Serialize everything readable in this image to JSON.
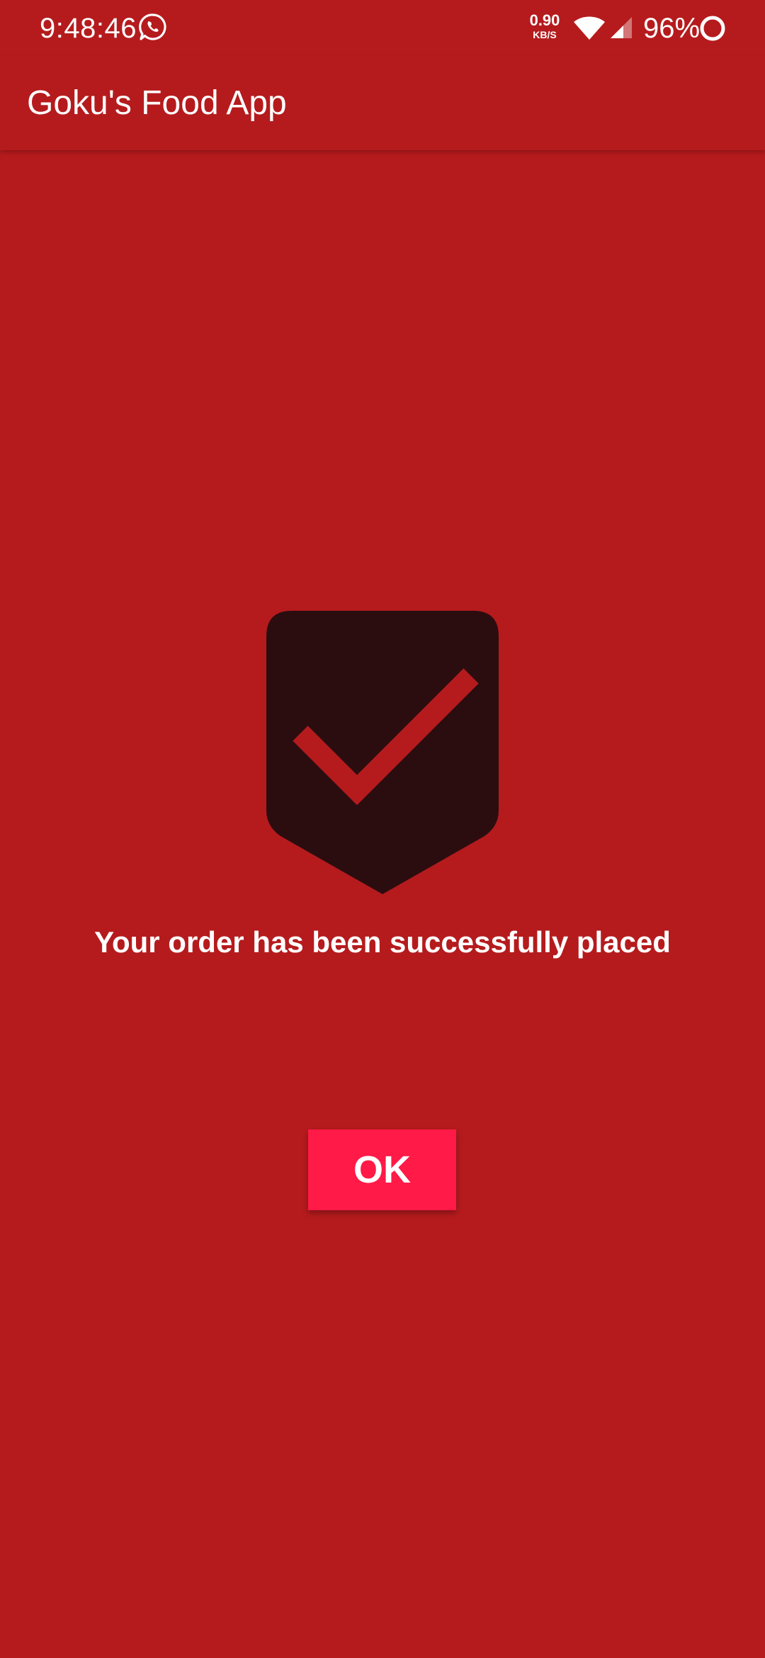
{
  "status_bar": {
    "time": "9:48:46",
    "net_speed_value": "0.90",
    "net_speed_unit": "KB/S",
    "battery_percent": "96%",
    "icons": [
      "whatsapp-icon",
      "wifi-icon",
      "signal-icon",
      "battery-icon"
    ]
  },
  "app_bar": {
    "title": "Goku's Food App"
  },
  "main": {
    "icon": "shield-check-icon",
    "message": "Your order has been successfully placed",
    "ok_label": "OK"
  },
  "colors": {
    "background": "#B51B1D",
    "shield": "#2B0D10",
    "check": "#B51B1D",
    "button": "#FF1A47",
    "text": "#FFFFFF"
  }
}
